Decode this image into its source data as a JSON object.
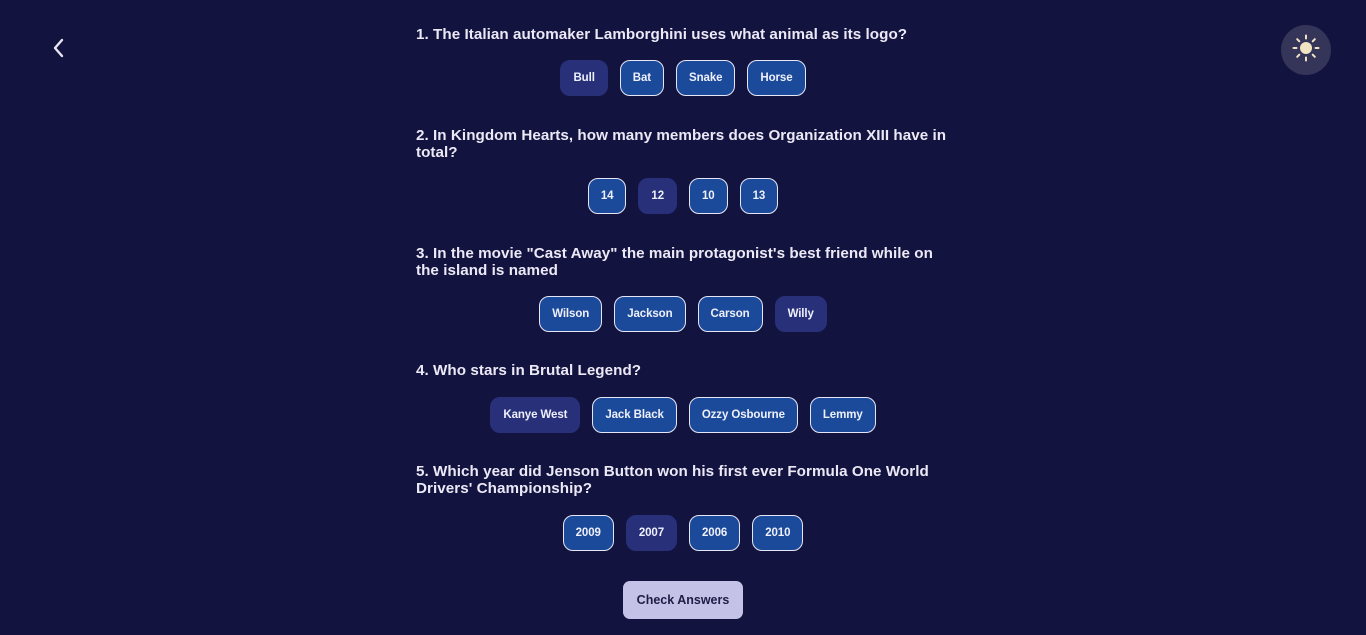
{
  "nav": {
    "back_icon": "chevron-left-icon",
    "theme_icon": "sun-icon"
  },
  "questions": [
    {
      "text": "1. The Italian automaker Lamborghini uses what animal as its logo?",
      "answers": [
        "Bull",
        "Bat",
        "Snake",
        "Horse"
      ],
      "selected": "Bull"
    },
    {
      "text": "2. In Kingdom Hearts, how many members does Organization XIII have in total?",
      "answers": [
        "14",
        "12",
        "10",
        "13"
      ],
      "selected": "12"
    },
    {
      "text": "3. In the movie \"Cast Away\" the main protagonist's best friend while on the island is named",
      "answers": [
        "Wilson",
        "Jackson",
        "Carson",
        "Willy"
      ],
      "selected": "Willy"
    },
    {
      "text": "4. Who stars in Brutal Legend?",
      "answers": [
        "Kanye West",
        "Jack Black",
        "Ozzy Osbourne",
        "Lemmy"
      ],
      "selected": "Kanye West"
    },
    {
      "text": "5. Which year did Jenson Button won his first ever Formula One World Drivers' Championship?",
      "answers": [
        "2009",
        "2007",
        "2006",
        "2010"
      ],
      "selected": "2007"
    }
  ],
  "check_button": {
    "label": "Check Answers"
  },
  "colors": {
    "background": "#13133f",
    "answer": "#1c4a9a",
    "answer_selected": "#28307a",
    "check_button": "#c4c2e6"
  }
}
